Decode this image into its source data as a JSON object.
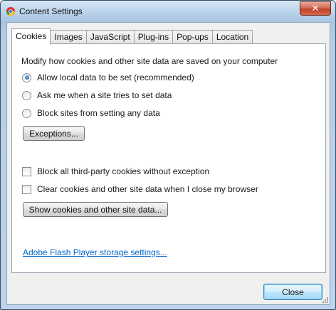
{
  "window": {
    "title": "Content Settings",
    "close_glyph": "✕"
  },
  "tabs": [
    {
      "label": "Cookies",
      "active": true
    },
    {
      "label": "Images",
      "active": false
    },
    {
      "label": "JavaScript",
      "active": false
    },
    {
      "label": "Plug-ins",
      "active": false
    },
    {
      "label": "Pop-ups",
      "active": false
    },
    {
      "label": "Location",
      "active": false
    }
  ],
  "cookies": {
    "description": "Modify how cookies and other site data are saved on your computer",
    "radios": [
      {
        "label": "Allow local data to be set (recommended)",
        "checked": true
      },
      {
        "label": "Ask me when a site tries to set data",
        "checked": false
      },
      {
        "label": "Block sites from setting any data",
        "checked": false
      }
    ],
    "exceptions_button": "Exceptions...",
    "checkboxes": [
      {
        "label": "Block all third-party cookies without exception",
        "checked": false
      },
      {
        "label": "Clear cookies and other site data when I close my browser",
        "checked": false
      }
    ],
    "show_cookies_button": "Show cookies and other site data...",
    "flash_link": "Adobe Flash Player storage settings..."
  },
  "footer": {
    "close_button": "Close"
  },
  "colors": {
    "accent": "#0066cc",
    "title_bar": "#bcd4ec"
  }
}
